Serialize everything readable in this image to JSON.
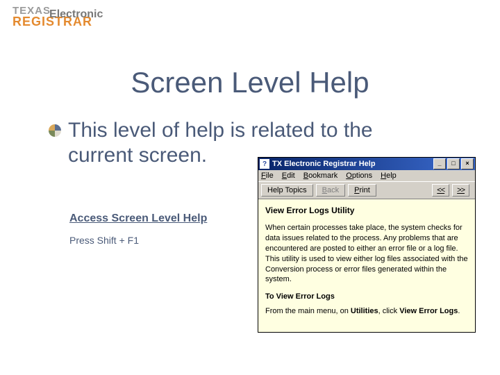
{
  "logo": {
    "line1a": "TEXAS",
    "line1b": "Electronic",
    "line2": "REGISTRAR"
  },
  "title": "Screen Level Help",
  "bullet": "This level of help is related to the current screen.",
  "sub": {
    "heading": "Access Screen Level Help",
    "body": "Press Shift + F1"
  },
  "help": {
    "caption": "TX Electronic Registrar Help",
    "appicon_glyph": "?",
    "win": {
      "min": "_",
      "max": "□",
      "close": "×"
    },
    "menu": [
      "File",
      "Edit",
      "Bookmark",
      "Options",
      "Help"
    ],
    "toolbar": {
      "topics": "Help Topics",
      "back": "Back",
      "print": "Print",
      "prev": "<<",
      "next": ">>"
    },
    "body": {
      "heading": "View Error Logs Utility",
      "para": "When certain processes take place, the system checks for data issues related to the process. Any problems that are encountered are posted to either an error file or a log file. This utility is used to view either log files associated with the Conversion process or error files generated within the system.",
      "sub_heading": "To View Error Logs",
      "step_prefix": "From the main menu, on ",
      "step_strong1": "Utilities",
      "step_mid": ", click ",
      "step_strong2": "View Error Logs",
      "step_suffix": "."
    }
  }
}
